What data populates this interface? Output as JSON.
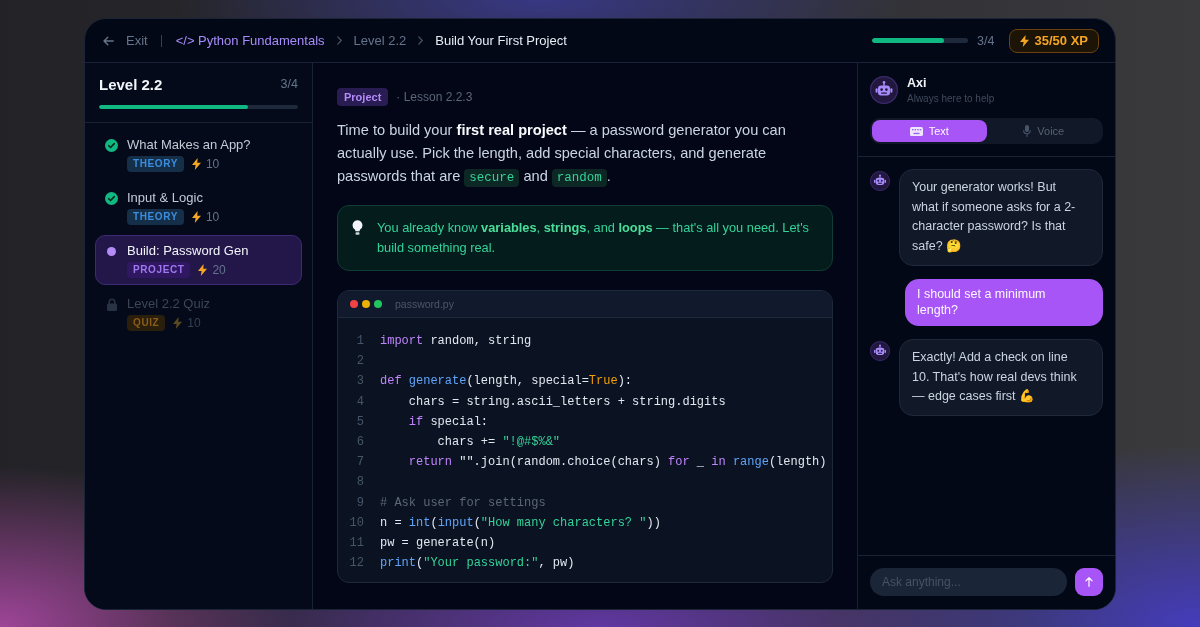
{
  "top_bar": {
    "exit": "Exit",
    "breadcrumb": [
      {
        "label": "</> Python Fundamentals",
        "kind": "course"
      },
      {
        "label": "Level 2.2",
        "kind": "level"
      },
      {
        "label": "Build Your First Project",
        "kind": "current"
      }
    ],
    "progress": {
      "level": 0.75,
      "reading": "3/4"
    },
    "xp": "35/50 XP"
  },
  "sidebar": {
    "title": "Level 2.2",
    "count": "3/4",
    "progress": {
      "level": 0.75
    },
    "items": [
      {
        "title": "What Makes an App?",
        "kind": "done",
        "selected": false,
        "tag": {
          "label": "THEORY",
          "color": "#152f49"
        },
        "xp": "10"
      },
      {
        "title": "Input & Logic",
        "kind": "done",
        "selected": false,
        "tag": {
          "label": "THEORY",
          "color": "#152f49"
        },
        "xp": "10"
      },
      {
        "title": "Build: Password Gen",
        "kind": "current",
        "selected": true,
        "tag": {
          "label": "PROJECT",
          "color": "#2f1761"
        },
        "xp": "20"
      },
      {
        "title": "Level 2.2 Quiz",
        "kind": "locked",
        "selected": false,
        "tag": {
          "label": "QUIZ",
          "color": "#2a1e0c"
        },
        "xp": "10"
      }
    ]
  },
  "lesson": {
    "badge": "Project",
    "meta": "· Lesson 2.2.3",
    "intro": [
      {
        "kind": "text",
        "text": "Time to build your **first real project** — a password generator you can actually use. Pick the length, add special characters, and generate passwords that are "
      },
      {
        "kind": "code",
        "text": "secure"
      },
      {
        "kind": "text",
        "text": " and "
      },
      {
        "kind": "code",
        "text": "random"
      },
      {
        "kind": "text",
        "text": "."
      }
    ],
    "tip": "You already know **variables**, **strings**, and **loops** — that's all you need. Let's build something real.",
    "code": {
      "filename": "password.py",
      "lines": [
        {
          "number": "1",
          "tokens": [
            {
              "text": "import",
              "kind": "keyword"
            },
            {
              "text": " random, string",
              "kind": "plain"
            }
          ]
        },
        {
          "number": "2"
        },
        {
          "number": "3",
          "tokens": [
            {
              "text": "def ",
              "kind": "keyword"
            },
            {
              "text": "generate",
              "kind": "function"
            },
            {
              "text": "(length, special=",
              "kind": "plain"
            },
            {
              "text": "True",
              "kind": "constant"
            },
            {
              "text": "):",
              "kind": "plain"
            }
          ]
        },
        {
          "number": "4",
          "tokens": [
            {
              "text": "    chars = string.ascii_letters + string.digits",
              "kind": "plain"
            }
          ]
        },
        {
          "number": "5",
          "tokens": [
            {
              "text": "    if",
              "kind": "keyword"
            },
            {
              "text": " special:",
              "kind": "plain"
            }
          ]
        },
        {
          "number": "6",
          "tokens": [
            {
              "text": "        chars += ",
              "kind": "plain"
            },
            {
              "text": "\"!@#$%&\"",
              "kind": "string"
            }
          ]
        },
        {
          "number": "7",
          "tokens": [
            {
              "text": "    return",
              "kind": "keyword"
            },
            {
              "text": " \"\".join(random.choice(chars) ",
              "kind": "plain"
            },
            {
              "text": "for",
              "kind": "keyword"
            },
            {
              "text": " _ ",
              "kind": "plain"
            },
            {
              "text": "in ",
              "kind": "keyword"
            },
            {
              "text": "range",
              "kind": "function"
            },
            {
              "text": "(length)",
              "kind": "plain"
            }
          ]
        },
        {
          "number": "8"
        },
        {
          "number": "9",
          "tokens": [
            {
              "text": "# Ask user for settings",
              "kind": "comment"
            }
          ]
        },
        {
          "number": "10",
          "tokens": [
            {
              "text": "n = ",
              "kind": "plain"
            },
            {
              "text": "int",
              "kind": "function"
            },
            {
              "text": "(",
              "kind": "plain"
            },
            {
              "text": "input",
              "kind": "function"
            },
            {
              "text": "(",
              "kind": "plain"
            },
            {
              "text": "\"How many characters? \"",
              "kind": "string"
            },
            {
              "text": "))",
              "kind": "plain"
            }
          ]
        },
        {
          "number": "11",
          "tokens": [
            {
              "text": "pw = generate(n)",
              "kind": "plain"
            }
          ]
        },
        {
          "number": "12",
          "tokens": [
            {
              "text": "print",
              "kind": "function"
            },
            {
              "text": "(",
              "kind": "plain"
            },
            {
              "text": "\"Your password:\"",
              "kind": "string"
            },
            {
              "text": ", pw)",
              "kind": "plain"
            }
          ]
        }
      ]
    }
  },
  "chat": {
    "name": "Axi",
    "subtitle": "Always here to help",
    "modes": [
      {
        "label": "Text",
        "kind": "text",
        "selected": true
      },
      {
        "label": "Voice",
        "kind": "voice",
        "selected": false
      }
    ],
    "messages": [
      {
        "kind": "bot",
        "text": "Your generator works! But what if someone asks for a 2-character password? Is that safe? 🤔"
      },
      {
        "kind": "user",
        "text": "I should set a minimum length?"
      },
      {
        "kind": "bot",
        "text": "Exactly! Add a check on line 10. That's how real devs think — edge cases first 💪"
      }
    ],
    "input": {
      "placeholder": "Ask anything..."
    }
  }
}
